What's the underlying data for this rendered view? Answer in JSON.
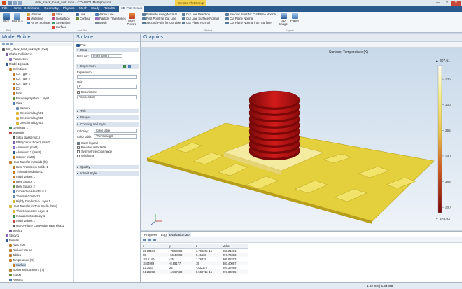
{
  "window": {
    "title": "disk_stack_heat_sink.mph - COMSOL Multiphysics",
    "context_tab": "Surface Plot Group"
  },
  "menu": [
    "File",
    "Home",
    "Definitions",
    "Geometry",
    "Physics",
    "Mesh",
    "Study",
    "Results",
    "3D Plot Group"
  ],
  "ribbon": {
    "plot": "Plot",
    "plot_in": "Plot In ▾",
    "add_plot": [
      "Volume",
      "Multislice",
      "Arrow Surface",
      "Slice",
      "Isosurface",
      "Streamline",
      "Surface",
      "Line",
      "Contour",
      "Arrow Line",
      "Particle Trajectories",
      "Mesh"
    ],
    "more_plots": "More Plots ▾",
    "select": [
      "Evaluate Along Normal",
      "First Point for Cut Line",
      "Second Point for Cut Line",
      "Cut Line Direction",
      "Cut Line Surface Normal",
      "Cut Plane Normal",
      "Second Point for Cut Plane Normal",
      "Cut Plane Normal",
      "Cut Plane Normal from Surface"
    ],
    "export": [
      "3D Image",
      "Player"
    ],
    "groups": {
      "plot": "Plot",
      "add_plot": "Add Plot",
      "select": "Select",
      "export": "Export"
    }
  },
  "model_builder": {
    "title": "Model Builder",
    "tree": [
      "disk_stack_heat_sink.mph (root)",
      "Global Definitions",
      "Parameters",
      "Model 1 (mod1)",
      "Definitions",
      "ICs Type 1",
      "ICs Type 2",
      "ICs Type 3",
      "ICs",
      "Fins",
      "Boundary System 1 (sys1)",
      "View 1",
      "Camera",
      "Directional Light 1",
      "Directional Light 2",
      "Directional Light 3",
      "Geometry 1",
      "Materials",
      "Silica glass (mat1)",
      "FR4 (Circuit Board) (mat2)",
      "Aluminum (mat3)",
      "Aluminum 2 (mat4)",
      "Copper (mat5)",
      "Heat Transfer in Solids (ht)",
      "Heat Transfer in Solids 1",
      "Thermal Insulation 1",
      "Initial Values 1",
      "Heat Source 1",
      "Heat Source 2",
      "Convective Heat Flux 1",
      "Thermal Contact 1",
      "Highly Conductive Layer 1",
      "Heat Transfer in Thin Shells (htsh)",
      "Thin Conductive Layer 1",
      "Insulation/Continuity 1",
      "Initial Values 1",
      "Out-of-Plane Convective Heat Flux 1",
      "Mesh 1",
      "Study 1",
      "Results",
      "Data Sets",
      "Derived Values",
      "Tables",
      "Temperature (ht)",
      "Surface",
      "Isothermal Contours (ht)",
      "Export",
      "Reports"
    ]
  },
  "settings": {
    "title": "Surface",
    "plot_btn": "Plot",
    "sec_data": "Data",
    "data_set_label": "Data set:",
    "data_set": "From parent",
    "sec_expr": "Expression",
    "expr_label": "Expression:",
    "expr": "T",
    "unit_label": "Unit:",
    "unit": "K",
    "description_label": "Description:",
    "description": "Temperature",
    "sec_title": "Title",
    "sec_range": "Range",
    "sec_coloring": "Coloring and Style",
    "coloring_label": "Coloring:",
    "coloring": "Color table",
    "color_table_label": "Color table:",
    "color_table": "ThermalLight",
    "cb_legend": "Color legend",
    "cb_reverse": "Reverse color table",
    "cb_symmetrize": "Symmetrize color range",
    "cb_wire": "Wireframe",
    "sec_quality": "Quality",
    "sec_inherit": "Inherit Style"
  },
  "graphics": {
    "title": "Graphics",
    "plot_title": "Surface: Temperature (K)",
    "max": "▲ 307.61",
    "min": "▼ 278.93",
    "ticks": [
      "305",
      "300",
      "295",
      "290",
      "285",
      "280"
    ]
  },
  "bottom": {
    "tabs": [
      "Progress",
      "Log",
      "Evaluation 3D"
    ],
    "columns": [
      "x",
      "y",
      "z",
      "Value"
    ],
    "rows": [
      [
        "59.18484",
        "-73.53001",
        "1.79636e-15",
        "283.21081"
      ],
      [
        "20",
        "-56.48008",
        "0.41633",
        "297.72313"
      ],
      [
        "-23.51474",
        "-25",
        "1.76478",
        "305.88203"
      ],
      [
        "-3.44989",
        "-8.88177",
        "18",
        "303.40087"
      ],
      [
        "41.3083",
        "25",
        "-0.32272",
        "294.37069"
      ],
      [
        "24.25293",
        "-44.67538",
        "5.55271e-15",
        "297.33285"
      ]
    ]
  },
  "status": {
    "memory": "1.22 GB | 1.34 GB"
  },
  "colors": {
    "accent": "#2b5a8e",
    "board": "#e9d64a",
    "hot": "#a31010"
  }
}
